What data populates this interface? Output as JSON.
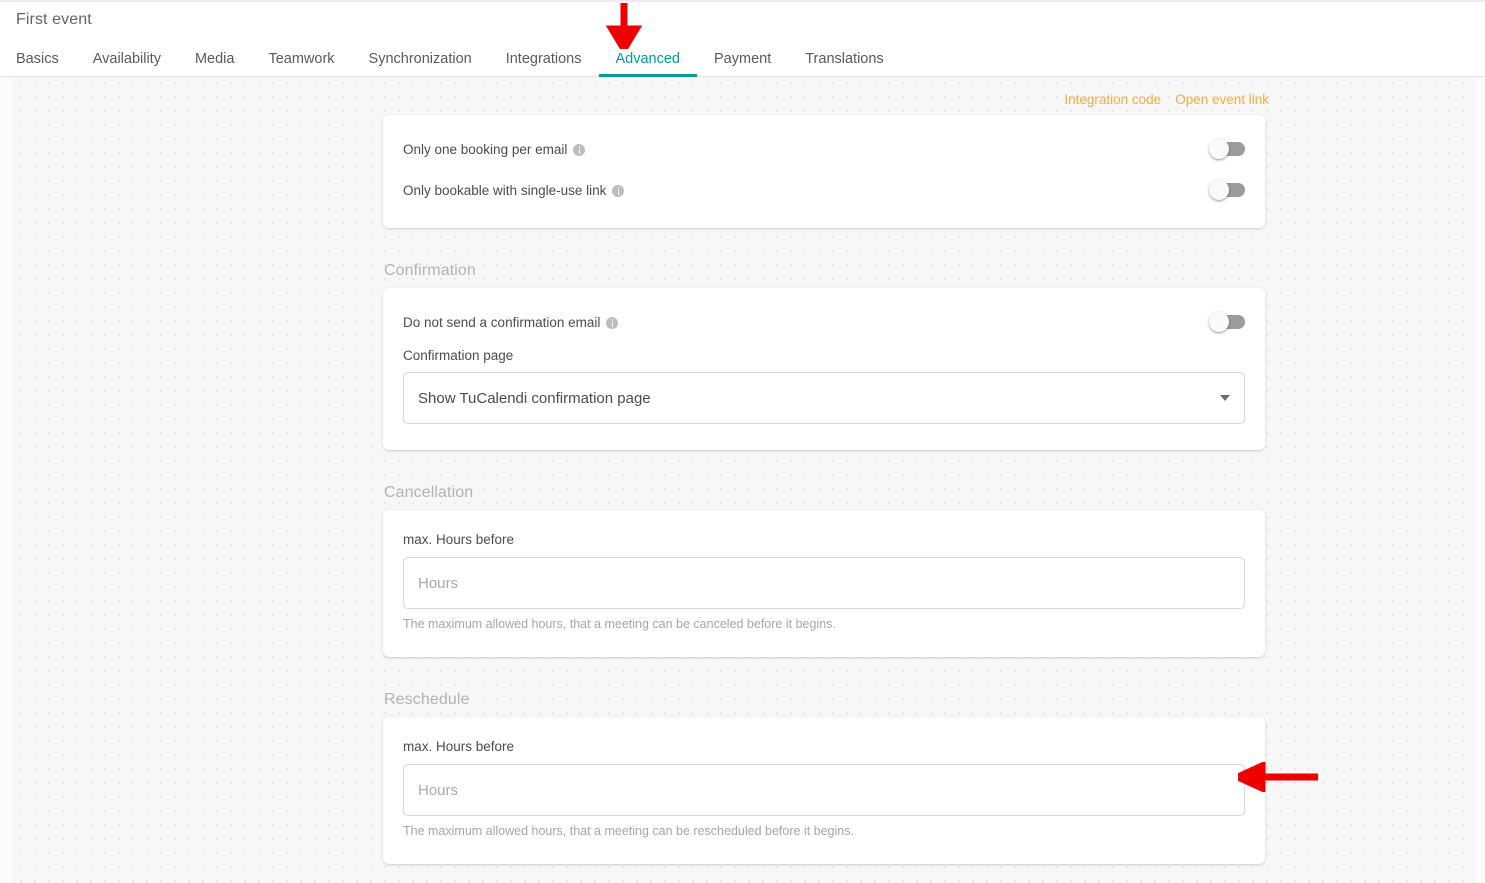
{
  "header": {
    "event_title": "First event",
    "tabs": [
      {
        "label": "Basics",
        "active": false
      },
      {
        "label": "Availability",
        "active": false
      },
      {
        "label": "Media",
        "active": false
      },
      {
        "label": "Teamwork",
        "active": false
      },
      {
        "label": "Synchronization",
        "active": false
      },
      {
        "label": "Integrations",
        "active": false
      },
      {
        "label": "Advanced",
        "active": true
      },
      {
        "label": "Payment",
        "active": false
      },
      {
        "label": "Translations",
        "active": false
      }
    ]
  },
  "top_links": {
    "integration_code": "Integration code",
    "open_event_link": "Open event link"
  },
  "booking_card": {
    "rows": [
      {
        "label": "Only one booking per email",
        "info": "info-icon",
        "toggle": "off"
      },
      {
        "label": "Only bookable with single-use link",
        "info": "info-icon",
        "toggle": "off"
      }
    ]
  },
  "confirmation": {
    "section_label": "Confirmation",
    "toggle_label": "Do not send a confirmation email",
    "toggle_state": "off",
    "page_label": "Confirmation page",
    "page_value": "Show TuCalendi confirmation page"
  },
  "cancellation": {
    "section_label": "Cancellation",
    "field_label": "max. Hours before",
    "field_value": "",
    "field_placeholder": "Hours",
    "help_text": "The maximum allowed hours, that a meeting can be canceled before it begins."
  },
  "reschedule": {
    "section_label": "Reschedule",
    "field_label": "max. Hours before",
    "field_value": "",
    "field_placeholder": "Hours",
    "help_text": "The maximum allowed hours, that a meeting can be rescheduled before it begins."
  },
  "annotations": {
    "color": "#ee0000",
    "arrow_down_target": "Advanced",
    "arrow_left_target": "reschedule-hours-input"
  },
  "colors": {
    "accent_teal": "#009e91",
    "link_amber": "#f0ad3e",
    "annotation_red": "#ee0000",
    "page_background": "#f7f7f7",
    "card_background": "#ffffff"
  }
}
